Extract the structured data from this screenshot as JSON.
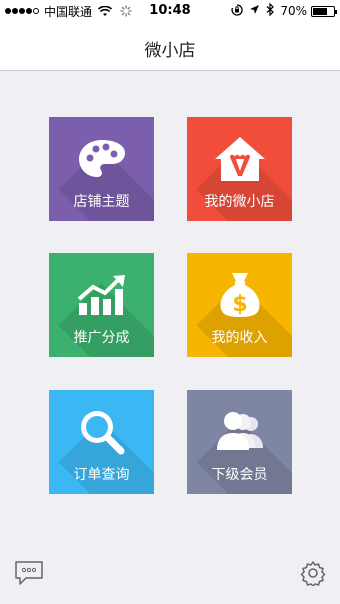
{
  "status_bar": {
    "carrier": "中国联通",
    "time": "10:48",
    "battery": "70%",
    "battery_level": 0.7
  },
  "nav": {
    "title": "微小店"
  },
  "tiles": [
    {
      "label": "店铺主题",
      "icon": "palette-icon",
      "color": "#7b5fad"
    },
    {
      "label": "我的微小店",
      "icon": "shop-house-icon",
      "color": "#f04d3a"
    },
    {
      "label": "推广分成",
      "icon": "growth-chart-icon",
      "color": "#3cb06e"
    },
    {
      "label": "我的收入",
      "icon": "money-bag-icon",
      "color": "#f7b500"
    },
    {
      "label": "订单查询",
      "icon": "search-icon",
      "color": "#3bb8f3"
    },
    {
      "label": "下级会员",
      "icon": "members-icon",
      "color": "#7f86a3"
    }
  ],
  "bottom": {
    "left_icon": "chat-icon",
    "right_icon": "gear-icon"
  }
}
